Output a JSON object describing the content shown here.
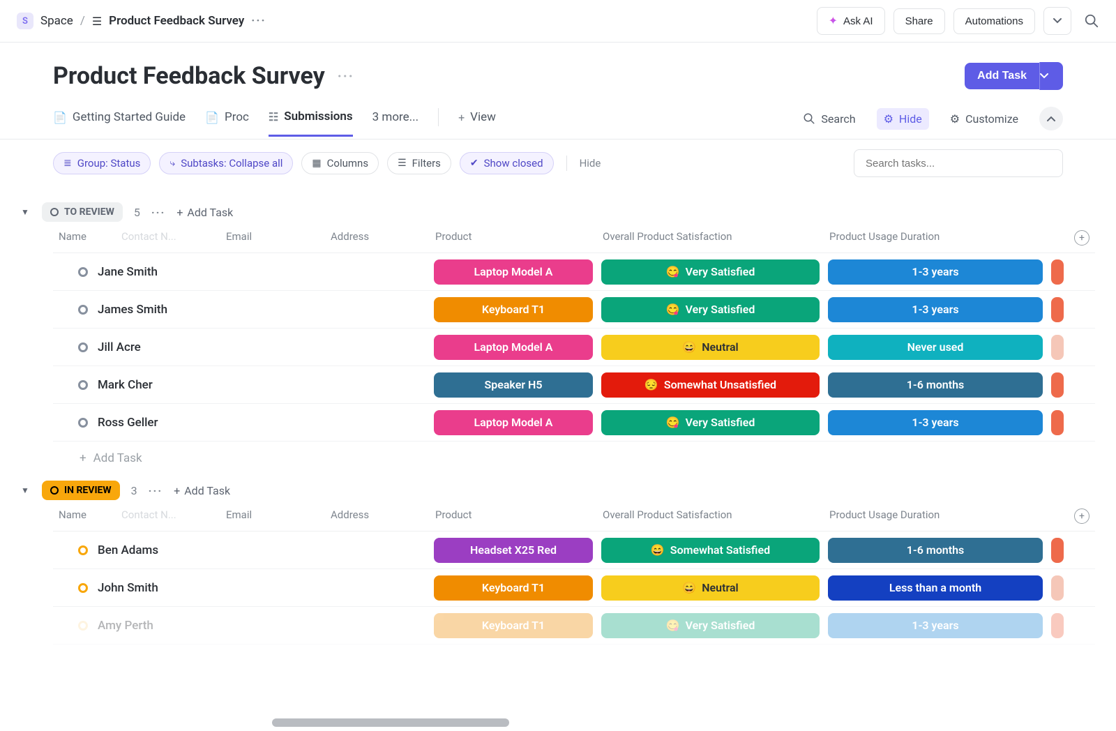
{
  "breadcrumb": {
    "space": "Space",
    "space_initial": "S",
    "page": "Product Feedback Survey"
  },
  "top_actions": {
    "ask_ai": "Ask AI",
    "share": "Share",
    "automations": "Automations"
  },
  "header": {
    "title": "Product Feedback Survey",
    "add_task": "Add Task"
  },
  "tabs": {
    "t1": "Getting Started Guide",
    "t2": "Proc",
    "t3": "Submissions",
    "more": "3 more...",
    "view": "View"
  },
  "tools": {
    "search": "Search",
    "hide": "Hide",
    "customize": "Customize"
  },
  "filters": {
    "group": "Group: Status",
    "subtasks": "Subtasks: Collapse all",
    "columns": "Columns",
    "filters": "Filters",
    "show_closed": "Show closed",
    "hide": "Hide",
    "search_placeholder": "Search tasks..."
  },
  "columns": {
    "name": "Name",
    "contact": "Contact N...",
    "email": "Email",
    "address": "Address",
    "product": "Product",
    "satisfaction": "Overall Product Satisfaction",
    "duration": "Product Usage Duration"
  },
  "groups": [
    {
      "id": "to_review",
      "label": "TO REVIEW",
      "count": "5",
      "style": "gray",
      "rows": [
        {
          "name": "Jane Smith",
          "product": {
            "text": "Laptop Model A",
            "cls": "c-pink"
          },
          "sat": {
            "emoji": "😋",
            "text": "Very Satisfied",
            "cls": "c-teal"
          },
          "dur": {
            "text": "1-3 years",
            "cls": "c-blue"
          },
          "extra": "c-coral"
        },
        {
          "name": "James Smith",
          "product": {
            "text": "Keyboard T1",
            "cls": "c-orange"
          },
          "sat": {
            "emoji": "😋",
            "text": "Very Satisfied",
            "cls": "c-teal"
          },
          "dur": {
            "text": "1-3 years",
            "cls": "c-blue"
          },
          "extra": "c-coral"
        },
        {
          "name": "Jill Acre",
          "product": {
            "text": "Laptop Model A",
            "cls": "c-pink"
          },
          "sat": {
            "emoji": "😄",
            "text": "Neutral",
            "cls": "c-yellow"
          },
          "dur": {
            "text": "Never used",
            "cls": "c-cyan"
          },
          "extra": "c-coral-lt"
        },
        {
          "name": "Mark Cher",
          "product": {
            "text": "Speaker H5",
            "cls": "c-steel"
          },
          "sat": {
            "emoji": "😔",
            "text": "Somewhat Unsatisfied",
            "cls": "c-red"
          },
          "dur": {
            "text": "1-6 months",
            "cls": "c-steel"
          },
          "extra": "c-coral"
        },
        {
          "name": "Ross Geller",
          "product": {
            "text": "Laptop Model A",
            "cls": "c-pink"
          },
          "sat": {
            "emoji": "😋",
            "text": "Very Satisfied",
            "cls": "c-teal"
          },
          "dur": {
            "text": "1-3 years",
            "cls": "c-blue"
          },
          "extra": "c-coral"
        }
      ],
      "add_row": "Add Task"
    },
    {
      "id": "in_review",
      "label": "IN REVIEW",
      "count": "3",
      "style": "orange",
      "rows": [
        {
          "name": "Ben Adams",
          "product": {
            "text": "Headset X25 Red",
            "cls": "c-purple"
          },
          "sat": {
            "emoji": "😄",
            "text": "Somewhat Satisfied",
            "cls": "c-teal"
          },
          "dur": {
            "text": "1-6 months",
            "cls": "c-steel"
          },
          "extra": "c-coral"
        },
        {
          "name": "John Smith",
          "product": {
            "text": "Keyboard T1",
            "cls": "c-orange"
          },
          "sat": {
            "emoji": "😄",
            "text": "Neutral",
            "cls": "c-yellow"
          },
          "dur": {
            "text": "Less than a month",
            "cls": "c-royal"
          },
          "extra": "c-coral-lt"
        },
        {
          "name": "Amy Perth",
          "faded": true,
          "product": {
            "text": "Keyboard T1",
            "cls": "c-orange"
          },
          "sat": {
            "emoji": "😋",
            "text": "Very Satisfied",
            "cls": "c-teal"
          },
          "dur": {
            "text": "1-3 years",
            "cls": "c-blue"
          },
          "extra": "c-coral"
        }
      ]
    }
  ],
  "misc": {
    "add_task_sm": "Add Task"
  }
}
